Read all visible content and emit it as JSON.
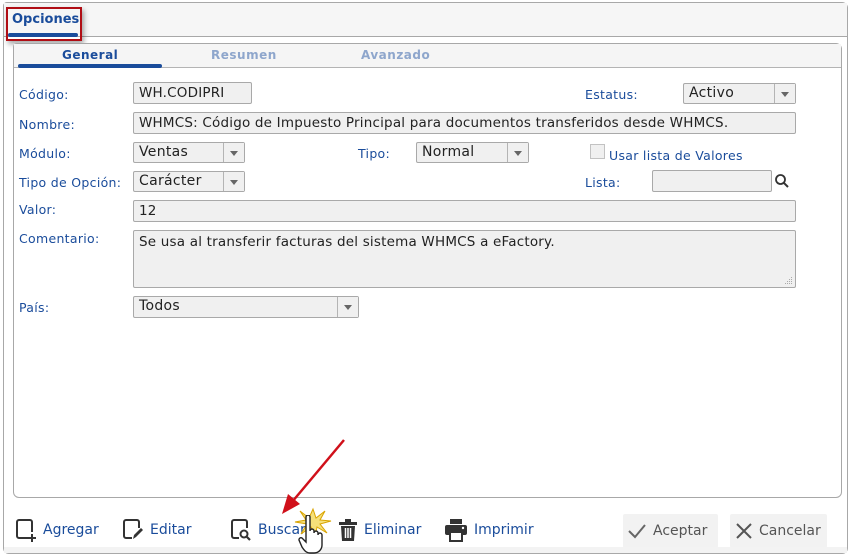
{
  "outer_tab": {
    "label": "Opciones"
  },
  "inner_tabs": [
    {
      "label": "General",
      "active": true
    },
    {
      "label": "Resumen",
      "active": false
    },
    {
      "label": "Avanzado",
      "active": false
    }
  ],
  "form": {
    "codigo": {
      "label": "Código:",
      "value": "WH.CODIPRI"
    },
    "estatus": {
      "label": "Estatus:",
      "value": "Activo"
    },
    "nombre": {
      "label": "Nombre:",
      "value": "WHMCS: Código de Impuesto Principal para documentos transferidos desde WHMCS."
    },
    "modulo": {
      "label": "Módulo:",
      "value": "Ventas"
    },
    "tipo": {
      "label": "Tipo:",
      "value": "Normal"
    },
    "usar_lista": {
      "label": "Usar lista de Valores",
      "checked": false
    },
    "tipo_opcion": {
      "label": "Tipo de Opción:",
      "value": "Carácter"
    },
    "lista": {
      "label": "Lista:",
      "value": ""
    },
    "valor": {
      "label": "Valor:",
      "value": "12"
    },
    "comentario": {
      "label": "Comentario:",
      "value": "Se usa al transferir facturas del sistema WHMCS a eFactory."
    },
    "pais": {
      "label": "País:",
      "value": "Todos"
    }
  },
  "toolbar": {
    "agregar": "Agregar",
    "editar": "Editar",
    "buscar": "Buscar",
    "eliminar": "Eliminar",
    "imprimir": "Imprimir",
    "aceptar": "Aceptar",
    "cancelar": "Cancelar"
  },
  "colors": {
    "accent": "#1a4c9b",
    "inactive_tab": "#8ea6cc",
    "highlight": "#b00d14",
    "field_bg": "#f0f0f0"
  }
}
